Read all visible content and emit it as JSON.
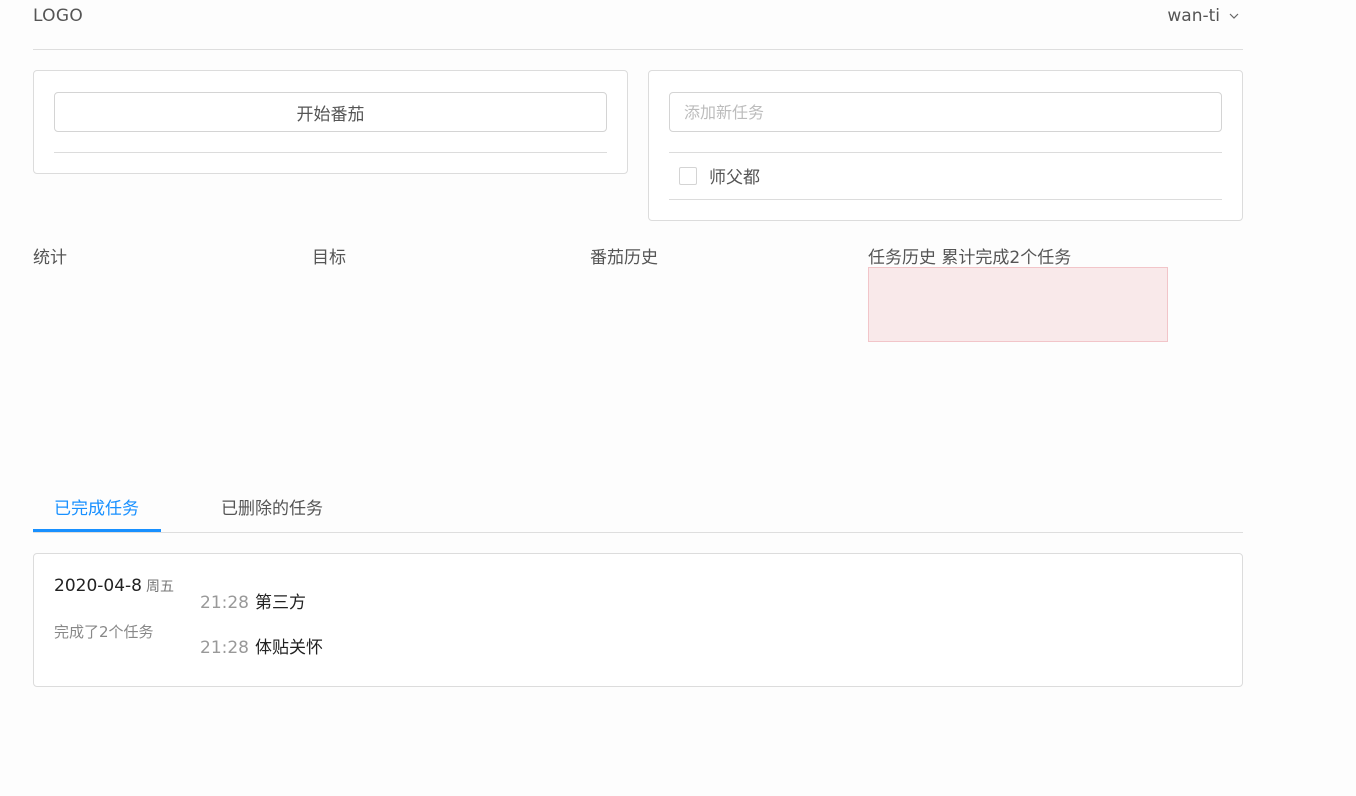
{
  "header": {
    "logo": "LOGO",
    "username": "wan-ti",
    "dropdown_icon": "chevron-down-icon"
  },
  "pomodoro": {
    "start_label": "开始番茄"
  },
  "todo": {
    "input_placeholder": "添加新任务",
    "items": [
      {
        "label": "师父都",
        "checked": false
      }
    ]
  },
  "stats": {
    "statistics": "统计",
    "goal": "目标",
    "pomodoro_history": "番茄历史",
    "task_history": "任务历史 累计完成2个任务"
  },
  "tabs": [
    {
      "label": "已完成任务",
      "active": true
    },
    {
      "label": "已删除的任务",
      "active": false
    }
  ],
  "history": {
    "date": "2020-04-8",
    "weekday": "周五",
    "summary": "完成了2个任务",
    "tasks": [
      {
        "time": "21:28",
        "text": "第三方"
      },
      {
        "time": "21:28",
        "text": "体贴关怀"
      }
    ]
  },
  "colors": {
    "accent": "#1890ff",
    "chart_fill": "#f9e9ea",
    "chart_border": "#f2c5c9"
  }
}
